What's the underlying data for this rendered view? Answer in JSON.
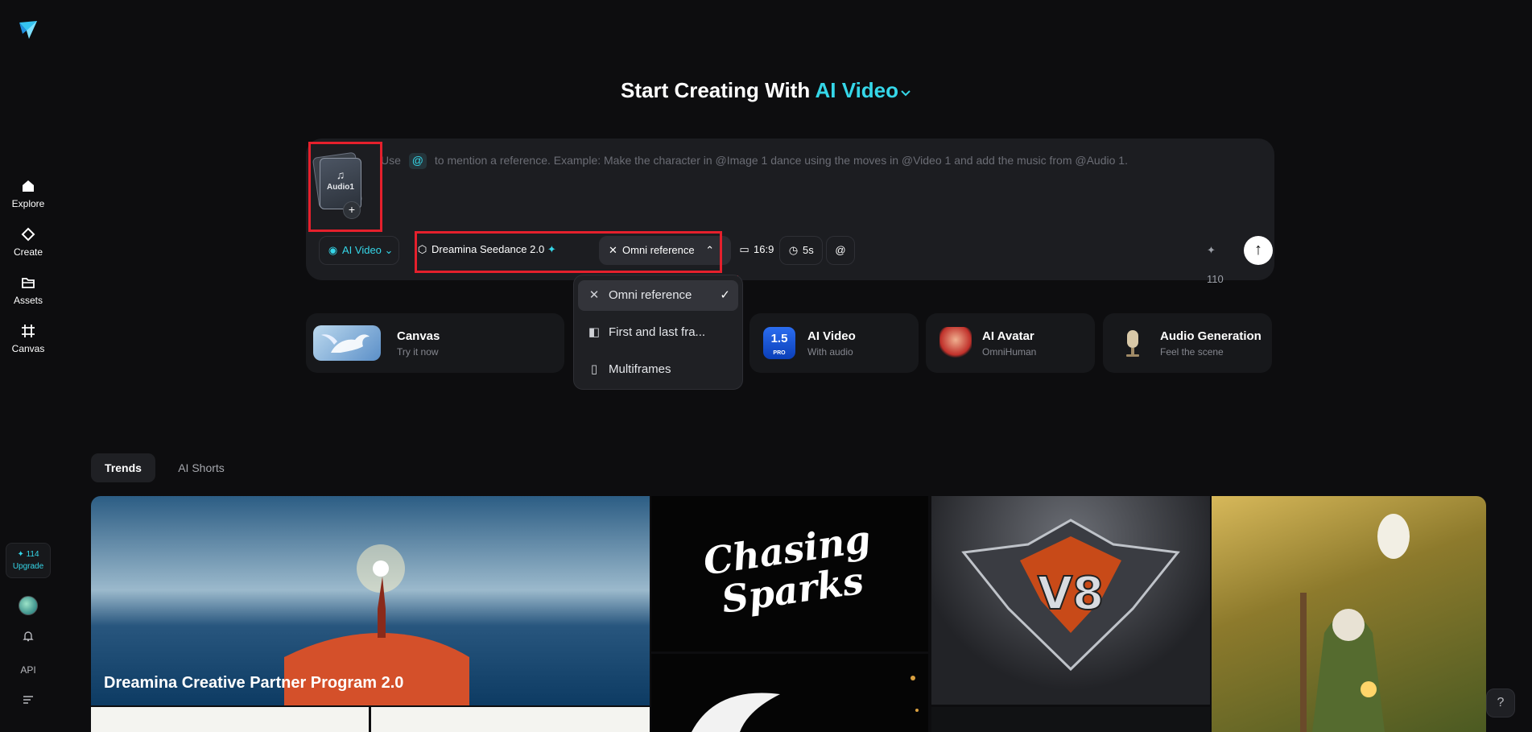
{
  "sidebar": {
    "nav": [
      {
        "label": "Explore",
        "icon": "home-icon"
      },
      {
        "label": "Create",
        "icon": "diamond-icon"
      },
      {
        "label": "Assets",
        "icon": "folder-icon"
      },
      {
        "label": "Canvas",
        "icon": "frame-icon"
      }
    ],
    "credits": "114",
    "upgrade_label": "Upgrade",
    "api_label": "API"
  },
  "hero": {
    "title_prefix": "Start Creating With",
    "title_accent": "AI Video"
  },
  "prompt": {
    "audio_ref_label": "Audio1",
    "placeholder_use": "Use",
    "placeholder_rest": "to mention a reference. Example: Make the character in @Image 1 dance using the moves in @Video 1 and add the music from @Audio 1."
  },
  "toolbar": {
    "mode": "AI Video",
    "model": "Dreamina Seedance 2.0",
    "reference": "Omni reference",
    "aspect": "16:9",
    "duration": "5s",
    "mention": "@",
    "cost": "110"
  },
  "reference_menu": {
    "items": [
      {
        "label": "Omni reference",
        "selected": true
      },
      {
        "label": "First and last fra...",
        "selected": false
      },
      {
        "label": "Multiframes",
        "selected": false
      }
    ]
  },
  "features": [
    {
      "title": "Canvas",
      "subtitle": "Try it now"
    },
    {
      "title": "AI Video",
      "subtitle": "With audio"
    },
    {
      "title": "AI Avatar",
      "subtitle": "OmniHuman"
    },
    {
      "title": "Audio Generation",
      "subtitle": "Feel the scene"
    }
  ],
  "tabs": [
    {
      "label": "Trends",
      "active": true
    },
    {
      "label": "AI Shorts",
      "active": false
    }
  ],
  "gallery": {
    "feature_title": "Dreamina Creative Partner Program 2.0",
    "chasing_line1": "Chasing",
    "chasing_line2": "Sparks",
    "badge_text": "V8",
    "version_badge": "1.5",
    "version_sub": "PRO"
  },
  "colors": {
    "accent": "#35d6e8",
    "background": "#0d0d0f",
    "highlight_box": "#e5202c"
  }
}
